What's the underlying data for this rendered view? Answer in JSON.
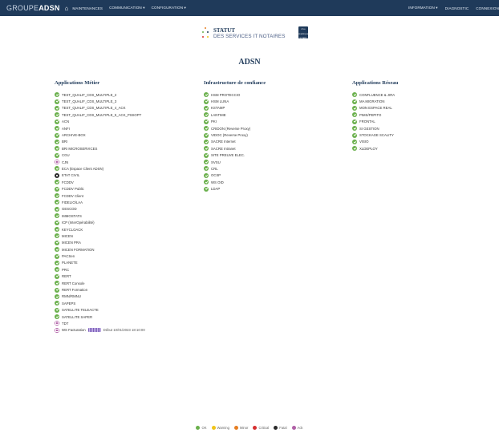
{
  "navbar": {
    "brand_part1": "GROUPE",
    "brand_part2": "ADSN",
    "home_icon": "home-icon",
    "left_items": [
      "MAINTENANCES",
      "COMMUNICATION ▾",
      "CONFIGURATION ▾"
    ],
    "right_items": [
      "INFORMATION ▾",
      "DIAGNOSTIC",
      "CONNEXION"
    ]
  },
  "header": {
    "logo_title": "STATUT",
    "logo_subtitle": "DES SERVICES IT NOTAIRES",
    "pole_logo_text": [
      "PÔLE",
      "NUMÉRIQUE",
      "NOTAIRE"
    ],
    "page_title": "ADSN"
  },
  "columns": {
    "metier": {
      "heading": "Applications Métier",
      "items": [
        {
          "label": "TEST_QUALIF_CDS_MULTIPLE_2",
          "status": "ok"
        },
        {
          "label": "TEST_QUALIF_CDS_MULTIPLE_3",
          "status": "ok"
        },
        {
          "label": "TEST_QUALIF_CDS_MULTIPLE_4_ACK",
          "status": "ok"
        },
        {
          "label": "TEST_QUALIF_CDS_MULTIPLE_5_ACK_PSSOPT",
          "status": "ok"
        },
        {
          "label": "ACN",
          "status": "ok"
        },
        {
          "label": "ANFI",
          "status": "ok"
        },
        {
          "label": "ARCHIVE-BOX",
          "status": "ok"
        },
        {
          "label": "BRI",
          "status": "ok"
        },
        {
          "label": "BRI MICROSERVICES",
          "status": "ok"
        },
        {
          "label": "CGU",
          "status": "ok"
        },
        {
          "label": "CJN",
          "status": "maintenance"
        },
        {
          "label": "ECA (Espace Client ADSN)",
          "status": "ok"
        },
        {
          "label": "ETAT CIVIL",
          "status": "fatal"
        },
        {
          "label": "FCDDV",
          "status": "ok"
        },
        {
          "label": "FCDDV Public",
          "status": "ok"
        },
        {
          "label": "FCDDV Client",
          "status": "ok"
        },
        {
          "label": "FIDELIO/LAA",
          "status": "ok"
        },
        {
          "label": "GESCOD",
          "status": "ok"
        },
        {
          "label": "IMMOSTATS",
          "status": "ok"
        },
        {
          "label": "ICP (InterOpérabilité)",
          "status": "ok"
        },
        {
          "label": "KEYCLOACK",
          "status": "ok"
        },
        {
          "label": "MICEN",
          "status": "ok"
        },
        {
          "label": "MICEN PRA",
          "status": "ok"
        },
        {
          "label": "MICEN FORMATION",
          "status": "ok"
        },
        {
          "label": "PACSen",
          "status": "ok"
        },
        {
          "label": "PLANETE",
          "status": "ok"
        },
        {
          "label": "PRC",
          "status": "ok"
        },
        {
          "label": "RERT",
          "status": "ok"
        },
        {
          "label": "RERT Console",
          "status": "ok"
        },
        {
          "label": "RERT Formation",
          "status": "ok"
        },
        {
          "label": "RMN/RMNU",
          "status": "ok"
        },
        {
          "label": "SAPEPS",
          "status": "ok"
        },
        {
          "label": "SATELLITE TELEACTE",
          "status": "ok"
        },
        {
          "label": "SATELLITE SAPER",
          "status": "ok"
        },
        {
          "label": "TDT",
          "status": "maintenance"
        },
        {
          "label": "WS Facturation",
          "status": "maintenance",
          "extra": "Début 10/01/2023 18:10:00"
        }
      ]
    },
    "infra": {
      "heading": "Infrastructure de confiance",
      "items": [
        {
          "label": "HSM PROTECCIO",
          "status": "ok"
        },
        {
          "label": "HSM LUNA",
          "status": "ok"
        },
        {
          "label": "KSTAMP",
          "status": "ok"
        },
        {
          "label": "LANTIME",
          "status": "ok"
        },
        {
          "label": "PKI",
          "status": "ok"
        },
        {
          "label": "CRIDON (Reverse Proxy)",
          "status": "ok"
        },
        {
          "label": "VIDOC (Reverse Proxy)",
          "status": "ok"
        },
        {
          "label": "SACRE Internet",
          "status": "ok"
        },
        {
          "label": "SACRE Intranet",
          "status": "ok"
        },
        {
          "label": "SITE PREUVE ELEC.",
          "status": "ok"
        },
        {
          "label": "SVSU",
          "status": "ok"
        },
        {
          "label": "CRL",
          "status": "ok"
        },
        {
          "label": "OCSP",
          "status": "ok"
        },
        {
          "label": "WS OID",
          "status": "ok"
        },
        {
          "label": "LDAP",
          "status": "ok"
        }
      ]
    },
    "reseau": {
      "heading": "Applications Réseau",
      "items": [
        {
          "label": "CONFLUENCE & JIRA",
          "status": "ok"
        },
        {
          "label": "MA MIGRATION",
          "status": "ok"
        },
        {
          "label": "MON ESPACE REAL",
          "status": "ok"
        },
        {
          "label": "PIMS/PEPITO",
          "status": "ok"
        },
        {
          "label": "FRONTAL",
          "status": "ok"
        },
        {
          "label": "SI GESTION",
          "status": "ok"
        },
        {
          "label": "STOCKAGE SCALITY",
          "status": "ok"
        },
        {
          "label": "VISIO",
          "status": "ok"
        },
        {
          "label": "XLDEPLOY",
          "status": "ok"
        }
      ]
    }
  },
  "legend": [
    {
      "label": "OK",
      "color": "#6ab04c"
    },
    {
      "label": "Warning",
      "color": "#f0c419"
    },
    {
      "label": "Minor",
      "color": "#e67e22"
    },
    {
      "label": "Critical",
      "color": "#d63031"
    },
    {
      "label": "Fatal",
      "color": "#2a2a2a"
    },
    {
      "label": "Ack",
      "color": "#b05fa6"
    }
  ],
  "colors": {
    "navbar_bg": "#1f3a5a",
    "ok": "#6ab04c",
    "maintenance": "#b05fa6",
    "fatal": "#2a2a2a"
  }
}
